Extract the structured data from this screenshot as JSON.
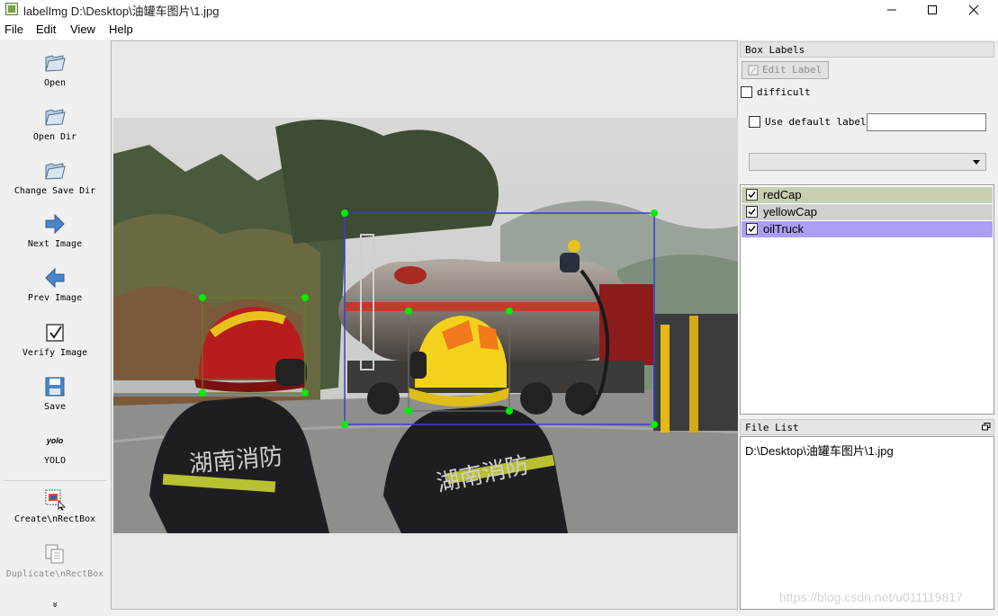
{
  "window": {
    "title": "labelImg D:\\Desktop\\油罐车图片\\1.jpg",
    "controls": [
      "minimize-icon",
      "maximize-icon",
      "close-icon"
    ]
  },
  "menu": {
    "file": "File",
    "edit": "Edit",
    "view": "View",
    "help": "Help"
  },
  "toolbar": {
    "open": "Open",
    "open_dir": "Open Dir",
    "change_save_dir": "Change Save Dir",
    "next_image": "Next Image",
    "prev_image": "Prev Image",
    "verify_image": "Verify Image",
    "save": "Save",
    "yolo_icon_text": "yolo",
    "yolo": "YOLO",
    "create_rectbox": "Create\\nRectBox",
    "duplicate_rectbox": "Duplicate\\nRectBox",
    "more": "»"
  },
  "box_labels": {
    "title": "Box Labels",
    "edit_label": "Edit Label",
    "difficult": "difficult",
    "use_default_label": "Use default label",
    "default_label_value": "",
    "dropdown_value": "",
    "labels": [
      {
        "name": "redCap",
        "checked": true,
        "color": "#c6d0b0"
      },
      {
        "name": "yellowCap",
        "checked": true,
        "color": "#d0d0d0"
      },
      {
        "name": "oilTruck",
        "checked": true,
        "color": "#aa9ff5"
      }
    ]
  },
  "file_list": {
    "title": "File List",
    "files": [
      "D:\\Desktop\\油罐车图片\\1.jpg"
    ]
  },
  "watermark": "https://blog.csdn.net/u011119817",
  "colors": {
    "handle": "#00ee00",
    "box_truck": "#3b3bd6",
    "box_redcap": "#6a7a2a",
    "box_yellowcap": "#6a6a6a"
  }
}
